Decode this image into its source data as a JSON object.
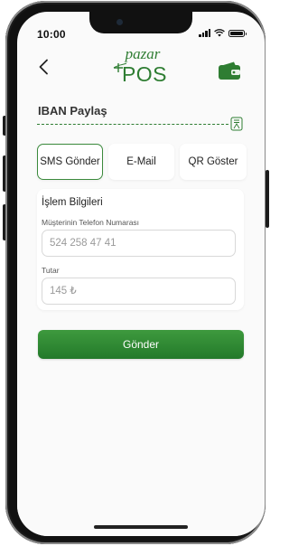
{
  "status_bar": {
    "time": "10:00"
  },
  "header": {
    "back_icon": "chevron-left-icon",
    "logo_top": "pazar",
    "logo_bottom": "POS",
    "wallet_icon": "wallet-icon"
  },
  "iban": {
    "title": "IBAN Paylaş",
    "side_icon": "bank-card-icon"
  },
  "tabs": [
    {
      "label": "SMS Gönder",
      "active": true
    },
    {
      "label": "E-Mail",
      "active": false
    },
    {
      "label": "QR Göster",
      "active": false
    }
  ],
  "form": {
    "title": "İşlem Bilgileri",
    "phone_label": "Müşterinin Telefon Numarası",
    "phone_placeholder": "524 258 47 41",
    "amount_label": "Tutar",
    "amount_placeholder": "145 ₺"
  },
  "actions": {
    "send_label": "Gönder"
  },
  "colors": {
    "brand_green": "#2e7d32",
    "button_green": "#2f8a33",
    "accent_border": "#3b8a3c"
  }
}
